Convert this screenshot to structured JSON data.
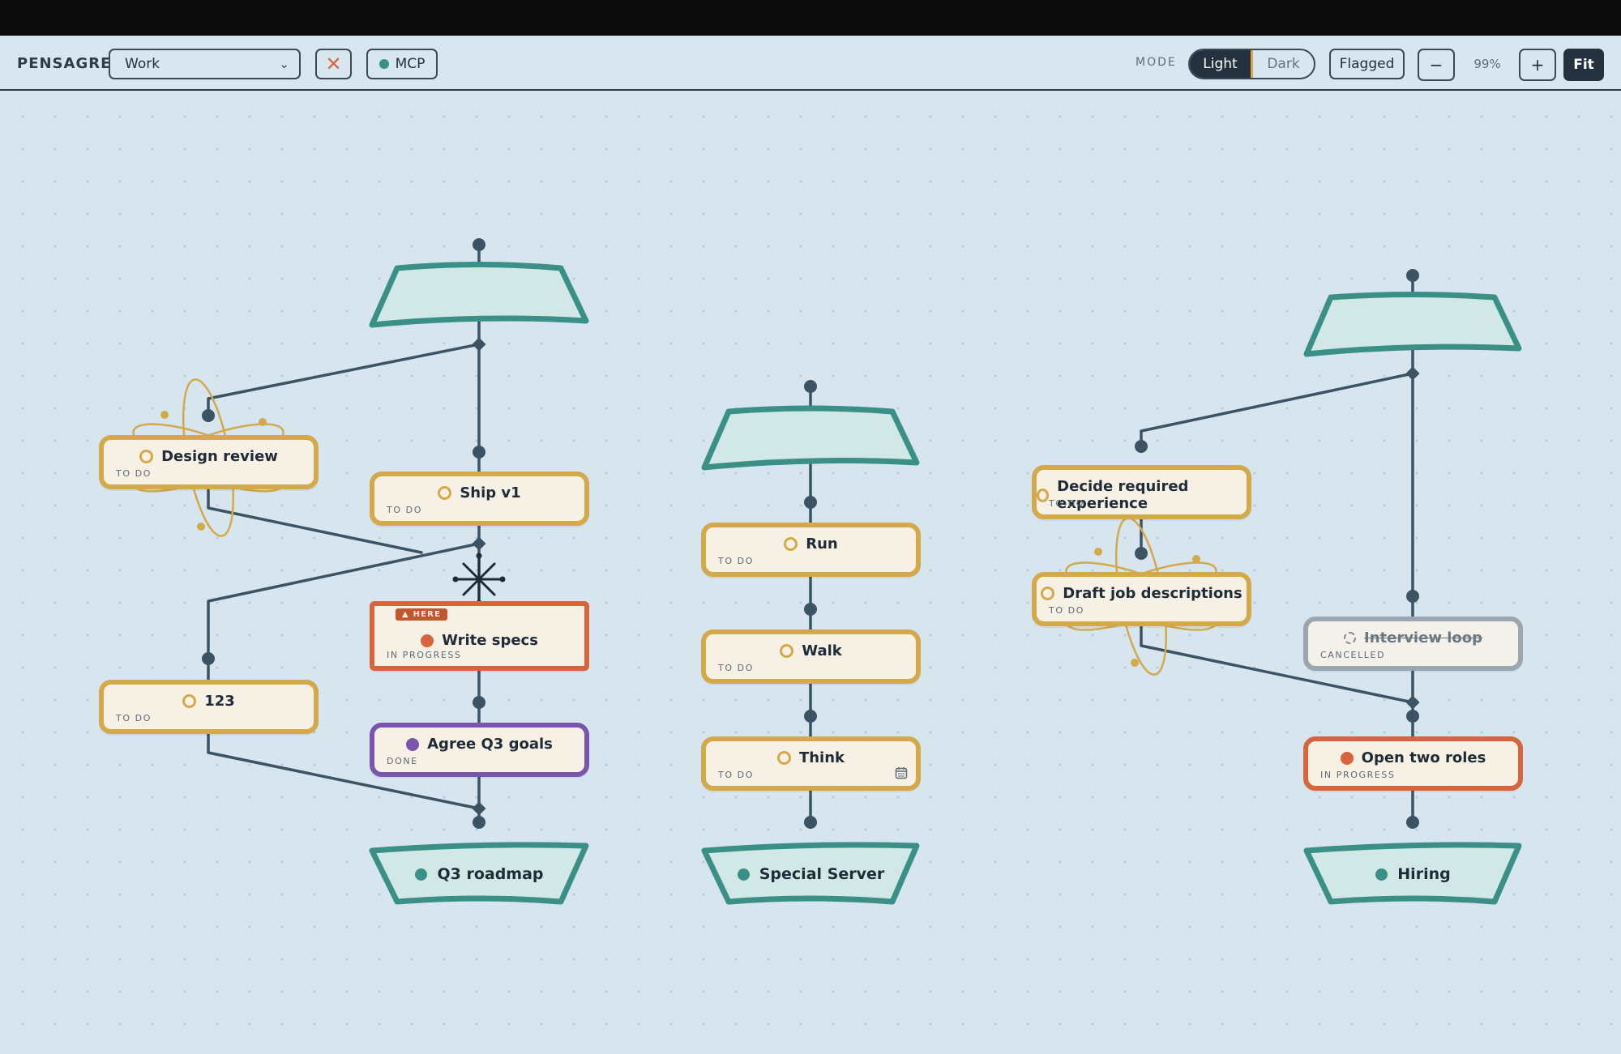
{
  "app": {
    "brand": "PENSAGREX"
  },
  "toolbar": {
    "workspace_select": "Work",
    "close_label": "✕",
    "mcp_label": "MCP",
    "mode_label": "MODE",
    "mode_light": "Light",
    "mode_dark": "Dark",
    "mode_selected": "Light",
    "flagged_label": "Flagged",
    "zoom_minus": "−",
    "zoom_value": "99%",
    "zoom_plus": "+",
    "fit_label": "Fit"
  },
  "colors": {
    "todo": "#d4a94a",
    "in_progress": "#d8643d",
    "done": "#7a55ad",
    "cancelled": "#9aa7b1",
    "goal": "#3a8f86",
    "edge": "#3c5364"
  },
  "goals": [
    {
      "id": "q3",
      "title": "Q3 roadmap"
    },
    {
      "id": "special",
      "title": "Special Server"
    },
    {
      "id": "hiring",
      "title": "Hiring"
    }
  ],
  "tasks": {
    "design_review": {
      "title": "Design review",
      "status": "TO DO"
    },
    "ship_v1": {
      "title": "Ship v1",
      "status": "TO DO"
    },
    "write_specs": {
      "title": "Write specs",
      "status": "IN PROGRESS",
      "badge": "▲ HERE"
    },
    "t123": {
      "title": "123",
      "status": "TO DO"
    },
    "agree_q3": {
      "title": "Agree Q3 goals",
      "status": "DONE"
    },
    "run": {
      "title": "Run",
      "status": "TO DO"
    },
    "walk": {
      "title": "Walk",
      "status": "TO DO"
    },
    "think": {
      "title": "Think",
      "status": "TO DO"
    },
    "decide_exp": {
      "title": "Decide required experience",
      "status": "TO DO"
    },
    "draft_jd": {
      "title": "Draft job descriptions",
      "status": "TO DO"
    },
    "interview_loop": {
      "title": "Interview loop",
      "status": "CANCELLED"
    },
    "open_roles": {
      "title": "Open two roles",
      "status": "IN PROGRESS"
    }
  }
}
